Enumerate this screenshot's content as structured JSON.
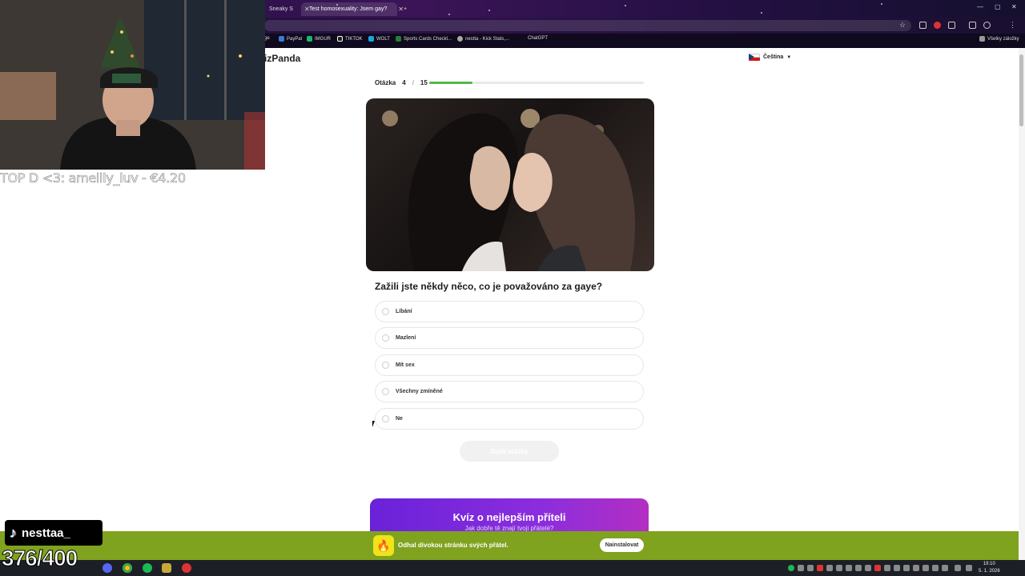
{
  "browser": {
    "tabs": [
      {
        "label": "Sneaky S",
        "active": false
      },
      {
        "label": "Test homosexuality: Jsem gay?",
        "active": true
      }
    ],
    "bookmarks": [
      "ge",
      "PayPal",
      "IMGUR",
      "TIKTOK",
      "WOLT",
      "Sports Cards Checkl...",
      "nestta - Kick Stats,...",
      "ChatGPT"
    ],
    "all_bookmarks_label": "Všetky záložky"
  },
  "page": {
    "logo": "izPanda",
    "language": "Čeština",
    "question_label": "Otázka",
    "question_current": "4",
    "question_total": "15",
    "progress_fraction": 0.2,
    "question_text": "Zažili jste někdy něco, co je považováno za gaye?",
    "options": [
      "Líbání",
      "Mazlení",
      "Mít sex",
      "Všechny zmíněné",
      "Ne"
    ],
    "next_button": "Další otázka",
    "promo": {
      "title": "Kvíz o nejlepším příteli",
      "subtitle": "Jak dobře tě znají tvoji přátelé?"
    },
    "install_bar": {
      "text": "Odhal divokou stránku svých přátel.",
      "button": "Nainstalovat"
    }
  },
  "taskbar": {
    "time": "19:10",
    "date": "5. 1. 2026"
  },
  "stream": {
    "donation": "TOP D <3: amelily_luv - €4.20",
    "tiktok_name": "nesttaa_",
    "counter": "376/400"
  },
  "colors": {
    "progress": "#52b848",
    "promo": "#7a28da",
    "install_bar": "#7fa21f"
  }
}
